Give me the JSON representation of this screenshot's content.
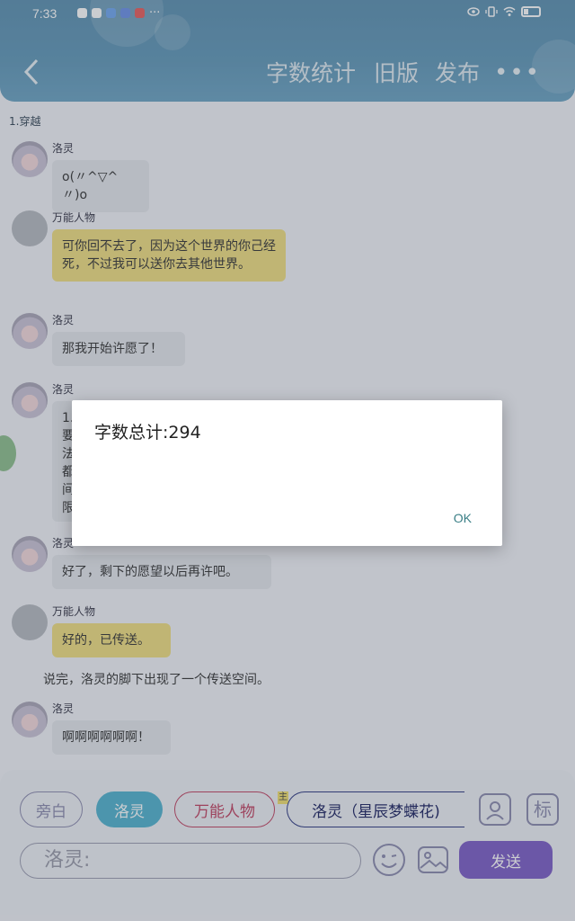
{
  "status_bar": {
    "time": "7:33",
    "more": "···"
  },
  "header": {
    "back_icon": "chevron-left-icon",
    "actions": [
      "字数统计",
      "旧版",
      "发布"
    ],
    "more": "•••"
  },
  "section_title": "1.穿越",
  "messages": [
    {
      "speaker": "洛灵",
      "text": "o(〃^▽^〃)o",
      "style": "grey"
    },
    {
      "speaker": "万能人物",
      "text": "可你回不去了，因为这个世界的你己经死，不过我可以送你去其他世界。",
      "style": "yellow"
    },
    {
      "speaker": "洛灵",
      "text": "那我开始许愿了！",
      "style": "grey"
    },
    {
      "speaker": "洛灵",
      "text": "1.\n要\n法\n都\n间\n限",
      "style": "grey"
    },
    {
      "speaker": "洛灵",
      "text": "好了，剩下的愿望以后再许吧。",
      "style": "grey"
    },
    {
      "speaker": "万能人物",
      "text": "好的，已传送。",
      "style": "yellow"
    },
    {
      "narration": "说完，洛灵的脚下出现了一个传送空间。"
    },
    {
      "speaker": "洛灵",
      "text": "啊啊啊啊啊啊！",
      "style": "grey"
    }
  ],
  "bottom": {
    "roles": [
      "旁白",
      "洛灵",
      "万能人物",
      "洛灵（星辰梦蝶花)"
    ],
    "main_tag": "主",
    "tag_label": "标",
    "input_placeholder": "洛灵:",
    "send_label": "发送"
  },
  "dialog": {
    "title": "字数总计:294",
    "ok_label": "OK"
  }
}
